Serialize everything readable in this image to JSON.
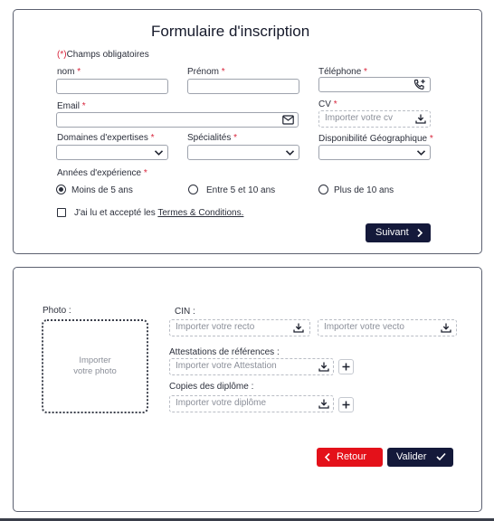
{
  "form1": {
    "title": "Formulaire d'inscription",
    "required_mark": "(*)",
    "required_note": "Champs obligatoires",
    "nom_label": "nom",
    "prenom_label": "Prénom",
    "telephone_label": "Téléphone",
    "email_label": "Email",
    "cv_label": "CV",
    "cv_placeholder": "Importer votre cv",
    "domaines_label": "Domaines d'expertises",
    "specialites_label": "Spécialités",
    "disponibilite_label": "Disponibilité Géographique",
    "annees_label": "Années d'expérience",
    "asterisk": "*",
    "experience_options": [
      {
        "label": "Moins de 5 ans",
        "selected": true
      },
      {
        "label": "Entre 5 et 10 ans",
        "selected": false
      },
      {
        "label": "Plus de 10 ans",
        "selected": false
      }
    ],
    "terms_prefix": "J'ai lu et accepté les",
    "terms_link": "Termes & Conditions.",
    "terms_checked": false,
    "next_button": "Suivant"
  },
  "form2": {
    "photo_label": "Photo :",
    "photo_placeholder_line1": "Importer",
    "photo_placeholder_line2": "votre photo",
    "cin_label": "CIN :",
    "cin_recto_placeholder": "Importer votre recto",
    "cin_verso_placeholder": "Importer votre vecto",
    "attestations_label": "Attestations de références :",
    "attestation_placeholder": "Importer votre Attestation",
    "diplomes_label": "Copies des diplôme :",
    "diplome_placeholder": "Importer votre diplôme",
    "back_button": "Retour",
    "validate_button": "Valider"
  },
  "colors": {
    "accent_dark": "#14193a",
    "accent_red": "#e4111a",
    "required_red": "#d8243b"
  },
  "icons": [
    "phone-add-icon",
    "mail-icon",
    "download-icon",
    "chevron-down-icon",
    "chevron-right-icon",
    "chevron-left-icon",
    "check-icon",
    "plus-icon"
  ]
}
